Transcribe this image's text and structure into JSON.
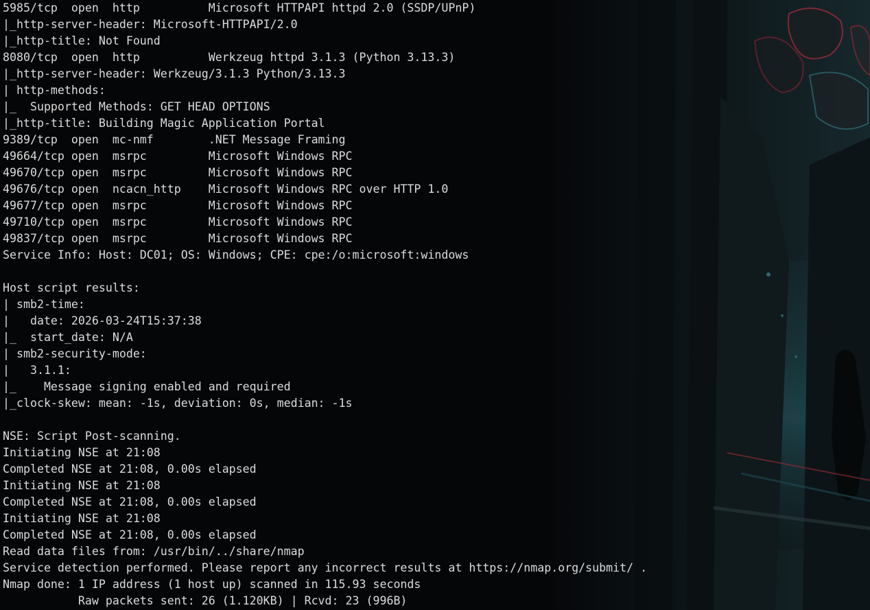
{
  "terminal": {
    "lines": [
      "5985/tcp  open  http          Microsoft HTTPAPI httpd 2.0 (SSDP/UPnP)",
      "|_http-server-header: Microsoft-HTTPAPI/2.0",
      "|_http-title: Not Found",
      "8080/tcp  open  http          Werkzeug httpd 3.1.3 (Python 3.13.3)",
      "|_http-server-header: Werkzeug/3.1.3 Python/3.13.3",
      "| http-methods:",
      "|_  Supported Methods: GET HEAD OPTIONS",
      "|_http-title: Building Magic Application Portal",
      "9389/tcp  open  mc-nmf        .NET Message Framing",
      "49664/tcp open  msrpc         Microsoft Windows RPC",
      "49670/tcp open  msrpc         Microsoft Windows RPC",
      "49676/tcp open  ncacn_http    Microsoft Windows RPC over HTTP 1.0",
      "49677/tcp open  msrpc         Microsoft Windows RPC",
      "49710/tcp open  msrpc         Microsoft Windows RPC",
      "49837/tcp open  msrpc         Microsoft Windows RPC",
      "Service Info: Host: DC01; OS: Windows; CPE: cpe:/o:microsoft:windows",
      "",
      "Host script results:",
      "| smb2-time:",
      "|   date: 2026-03-24T15:37:38",
      "|_  start_date: N/A",
      "| smb2-security-mode:",
      "|   3.1.1:",
      "|_    Message signing enabled and required",
      "|_clock-skew: mean: -1s, deviation: 0s, median: -1s",
      "",
      "NSE: Script Post-scanning.",
      "Initiating NSE at 21:08",
      "Completed NSE at 21:08, 0.00s elapsed",
      "Initiating NSE at 21:08",
      "Completed NSE at 21:08, 0.00s elapsed",
      "Initiating NSE at 21:08",
      "Completed NSE at 21:08, 0.00s elapsed",
      "Read data files from: /usr/bin/../share/nmap",
      "Service detection performed. Please report any incorrect results at https://nmap.org/submit/ .",
      "Nmap done: 1 IP address (1 host up) scanned in 115.93 seconds",
      "           Raw packets sent: 26 (1.120KB) | Rcvd: 23 (996B)"
    ]
  },
  "colors": {
    "background": "#050608",
    "foreground": "#dcdcdc",
    "wallpaper_teal": "#1e4a50",
    "wallpaper_red": "#9a2a3a"
  }
}
